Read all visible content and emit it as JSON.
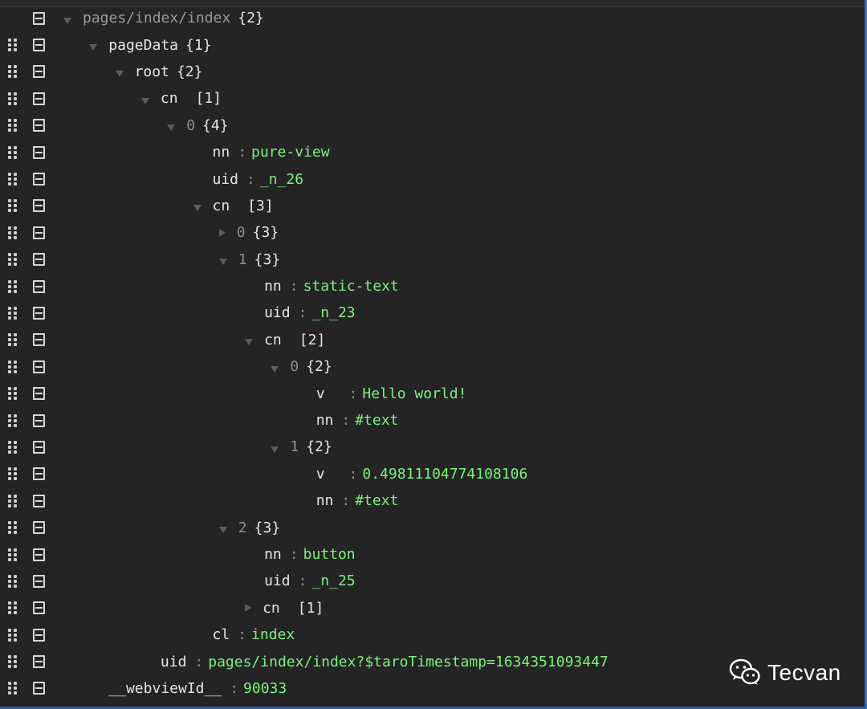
{
  "tree": {
    "rows": [
      {
        "key": "pages/index/index",
        "count": "{2}",
        "expanded": true,
        "depth": 0,
        "key_style": "dim",
        "first": true
      },
      {
        "key": "pageData",
        "count": "{1}",
        "expanded": true,
        "depth": 1
      },
      {
        "key": "root",
        "count": "{2}",
        "expanded": true,
        "depth": 2
      },
      {
        "key": "cn",
        "count": "[1]",
        "expanded": true,
        "depth": 3
      },
      {
        "key": "0",
        "count": "{4}",
        "expanded": true,
        "depth": 4,
        "key_style": "idx"
      },
      {
        "key": "nn",
        "value": "pure-view",
        "depth": 5
      },
      {
        "key": "uid",
        "value": "_n_26",
        "depth": 5
      },
      {
        "key": "cn",
        "count": "[3]",
        "expanded": true,
        "depth": 5
      },
      {
        "key": "0",
        "count": "{3}",
        "expanded": false,
        "depth": 6,
        "key_style": "idx"
      },
      {
        "key": "1",
        "count": "{3}",
        "expanded": true,
        "depth": 6,
        "key_style": "idx"
      },
      {
        "key": "nn",
        "value": "static-text",
        "depth": 7
      },
      {
        "key": "uid",
        "value": "_n_23",
        "depth": 7
      },
      {
        "key": "cn",
        "count": "[2]",
        "expanded": true,
        "depth": 7
      },
      {
        "key": "0",
        "count": "{2}",
        "expanded": true,
        "depth": 8,
        "key_style": "idx"
      },
      {
        "key": "v",
        "value": "Hello world!",
        "depth": 9,
        "colon_offset": 1
      },
      {
        "key": "nn",
        "value": "#text",
        "depth": 9
      },
      {
        "key": "1",
        "count": "{2}",
        "expanded": true,
        "depth": 8,
        "key_style": "idx"
      },
      {
        "key": "v",
        "value": "0.49811104774108106",
        "depth": 9,
        "colon_offset": 1
      },
      {
        "key": "nn",
        "value": "#text",
        "depth": 9
      },
      {
        "key": "2",
        "count": "{3}",
        "expanded": true,
        "depth": 6,
        "key_style": "idx"
      },
      {
        "key": "nn",
        "value": "button",
        "depth": 7
      },
      {
        "key": "uid",
        "value": "_n_25",
        "depth": 7
      },
      {
        "key": "cn",
        "count": "[1]",
        "expanded": false,
        "depth": 7
      },
      {
        "key": "cl",
        "value": "index",
        "depth": 5
      },
      {
        "key": "uid",
        "value": "pages/index/index?$taroTimestamp=1634351093447",
        "depth": 3,
        "leaf_shift": true
      },
      {
        "key": "__webviewId__",
        "value": "90033",
        "depth": 1,
        "leaf_shift": true
      }
    ]
  },
  "watermark": {
    "icon": "wechat-icon",
    "text": "Tecvan"
  },
  "colors": {
    "background": "#242424",
    "value": "#7ef07e",
    "key": "#e6e6e6",
    "index": "#8e8e8e"
  }
}
